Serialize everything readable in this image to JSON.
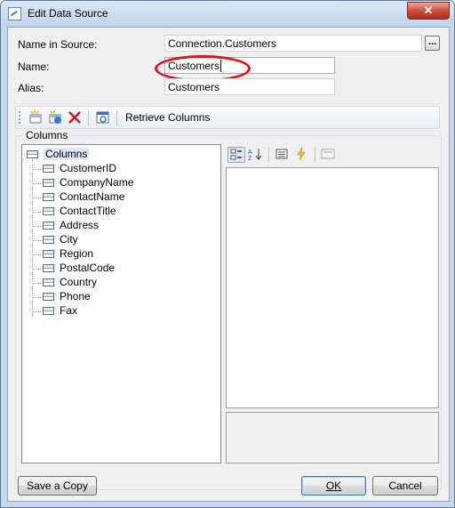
{
  "window": {
    "title": "Edit Data Source",
    "close_glyph": "✕"
  },
  "form": {
    "name_in_source_label": "Name in Source:",
    "name_in_source_value": "Connection.Customers",
    "name_label": "Name:",
    "name_value": "Customers",
    "alias_label": "Alias:",
    "alias_value": "Customers",
    "browse_label": "..."
  },
  "toolbar": {
    "icons": [
      "new-column-icon",
      "new-calc-column-icon",
      "delete-icon",
      "edit-icon"
    ],
    "retrieve_label": "Retrieve Columns"
  },
  "columns_group": {
    "title": "Columns",
    "root_label": "Columns",
    "items": [
      "CustomerID",
      "CompanyName",
      "ContactName",
      "ContactTitle",
      "Address",
      "City",
      "Region",
      "PostalCode",
      "Country",
      "Phone",
      "Fax"
    ]
  },
  "property_grid": {
    "icons": [
      "categorized-icon",
      "alphabetical-icon",
      "properties-icon",
      "events-icon",
      "property-pages-icon"
    ]
  },
  "buttons": {
    "save_copy": "Save a Copy",
    "ok": "OK",
    "cancel": "Cancel"
  },
  "colors": {
    "highlight_ring": "#e0121a",
    "accent": "#3c7fb1"
  }
}
